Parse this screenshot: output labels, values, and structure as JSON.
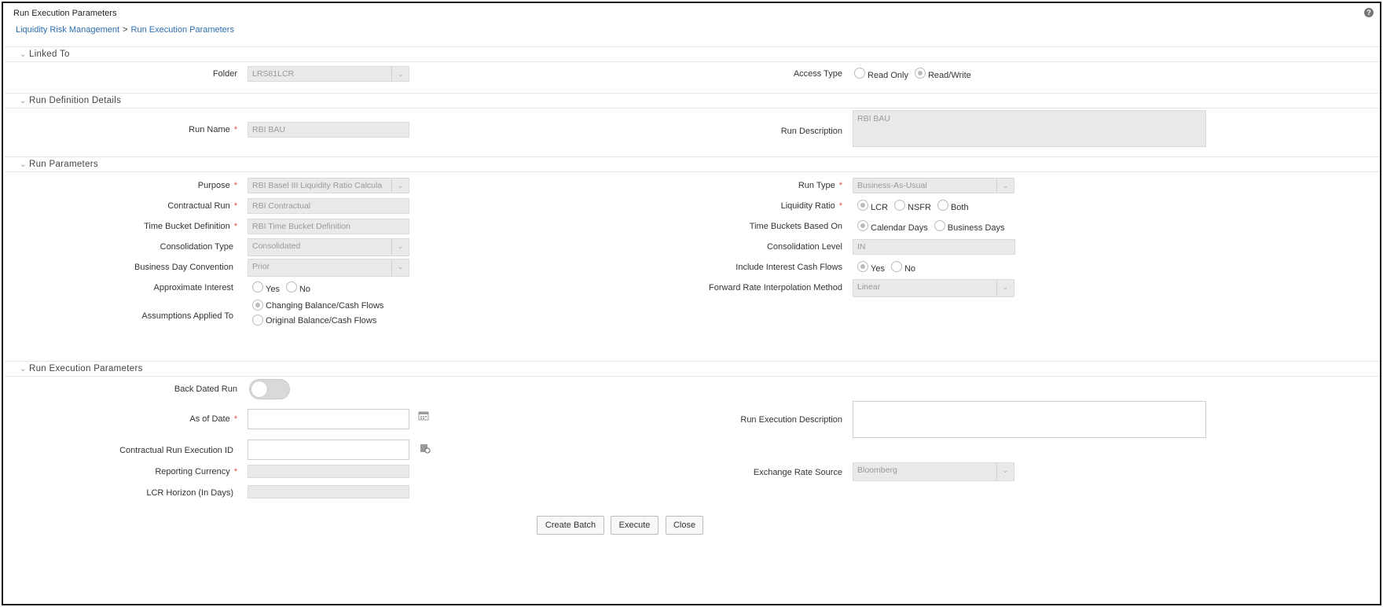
{
  "header": {
    "title": "Run Execution Parameters",
    "breadcrumb": [
      "Liquidity Risk Management",
      "Run Execution Parameters"
    ],
    "breadcrumb_sep": ">",
    "help_icon": "help-circle-icon",
    "help_glyph": "?"
  },
  "sections": {
    "linked_to": "Linked To",
    "run_definition": "Run Definition Details",
    "run_parameters": "Run Parameters",
    "run_execution": "Run Execution Parameters"
  },
  "linked_to": {
    "folder_label": "Folder",
    "folder_value": "LRS81LCR",
    "access_type_label": "Access Type",
    "access_options": [
      {
        "label": "Read Only",
        "checked": false
      },
      {
        "label": "Read/Write",
        "checked": true
      }
    ]
  },
  "run_definition": {
    "run_name_label": "Run Name",
    "run_name_value": "RBI BAU",
    "run_description_label": "Run Description",
    "run_description_value": "RBI BAU"
  },
  "run_parameters": {
    "purpose_label": "Purpose",
    "purpose_value": "RBI Basel III Liquidity Ratio Calcula",
    "contractual_run_label": "Contractual Run",
    "contractual_run_value": "RBI Contractual",
    "time_bucket_label": "Time Bucket Definition",
    "time_bucket_value": "RBI Time Bucket Definition",
    "consolidation_type_label": "Consolidation Type",
    "consolidation_type_value": "Consolidated",
    "business_day_label": "Business Day Convention",
    "business_day_value": "Prior",
    "approx_interest_label": "Approximate Interest",
    "approx_interest_options": [
      {
        "label": "Yes",
        "checked": false
      },
      {
        "label": "No",
        "checked": false
      }
    ],
    "assumptions_label": "Assumptions Applied To",
    "assumptions_options": [
      {
        "label": "Changing Balance/Cash Flows",
        "checked": true
      },
      {
        "label": "Original Balance/Cash Flows",
        "checked": false
      }
    ],
    "run_type_label": "Run Type",
    "run_type_value": "Business-As-Usual",
    "liquidity_ratio_label": "Liquidity Ratio",
    "liquidity_ratio_options": [
      {
        "label": "LCR",
        "checked": true
      },
      {
        "label": "NSFR",
        "checked": false
      },
      {
        "label": "Both",
        "checked": false
      }
    ],
    "time_buckets_based_label": "Time Buckets Based On",
    "time_buckets_based_options": [
      {
        "label": "Calendar Days",
        "checked": true
      },
      {
        "label": "Business Days",
        "checked": false
      }
    ],
    "consolidation_level_label": "Consolidation Level",
    "consolidation_level_value": "IN",
    "include_interest_label": "Include Interest Cash Flows",
    "include_interest_options": [
      {
        "label": "Yes",
        "checked": true
      },
      {
        "label": "No",
        "checked": false
      }
    ],
    "forward_rate_label": "Forward Rate Interpolation Method",
    "forward_rate_value": "Linear"
  },
  "run_execution": {
    "back_dated_label": "Back Dated Run",
    "back_dated_on": false,
    "as_of_date_label": "As of Date",
    "as_of_date_value": "",
    "calendar_icon": "calendar-icon",
    "contractual_exec_id_label": "Contractual Run Execution ID",
    "contractual_exec_id_value": "",
    "lookup_icon": "list-lookup-icon",
    "reporting_currency_label": "Reporting Currency",
    "reporting_currency_value": "",
    "lcr_horizon_label": "LCR Horizon (In Days)",
    "lcr_horizon_value": "",
    "run_exec_desc_label": "Run Execution Description",
    "run_exec_desc_value": "",
    "exchange_rate_label": "Exchange Rate Source",
    "exchange_rate_value": "Bloomberg"
  },
  "buttons": {
    "create_batch": "Create Batch",
    "execute": "Execute",
    "close": "Close"
  },
  "colors": {
    "required": "#d9534f",
    "link": "#2b6fb0"
  }
}
